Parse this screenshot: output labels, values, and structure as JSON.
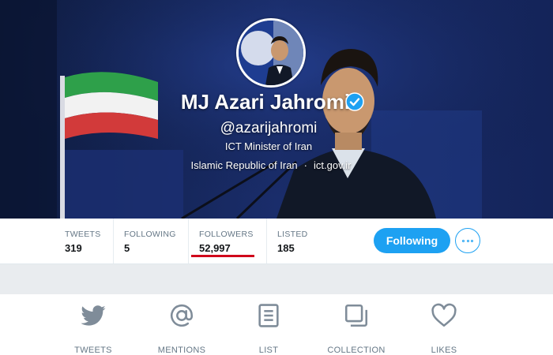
{
  "profile": {
    "name": "MJ Azari Jahromi",
    "handle": "@azarijahromi",
    "bio": "ICT Minister of Iran",
    "location": "Islamic Republic of Iran",
    "separator": "·",
    "website": "ict.gov.ir",
    "verified": true
  },
  "stats": [
    {
      "label": "TWEETS",
      "value": "319"
    },
    {
      "label": "FOLLOWING",
      "value": "5"
    },
    {
      "label": "FOLLOWERS",
      "value": "52,997"
    },
    {
      "label": "LISTED",
      "value": "185"
    }
  ],
  "actions": {
    "follow_label": "Following",
    "more_icon": "more-options-icon"
  },
  "tabs": [
    {
      "label": "TWEETS",
      "icon": "twitter-bird-icon"
    },
    {
      "label": "MENTIONS",
      "icon": "at-sign-icon"
    },
    {
      "label": "LIST",
      "icon": "list-icon"
    },
    {
      "label": "COLLECTION",
      "icon": "collection-icon"
    },
    {
      "label": "LIKES",
      "icon": "heart-icon"
    }
  ],
  "colors": {
    "accent": "#1da1f2",
    "highlight_underline": "#d0021b",
    "banner_bg": "#16234f"
  }
}
